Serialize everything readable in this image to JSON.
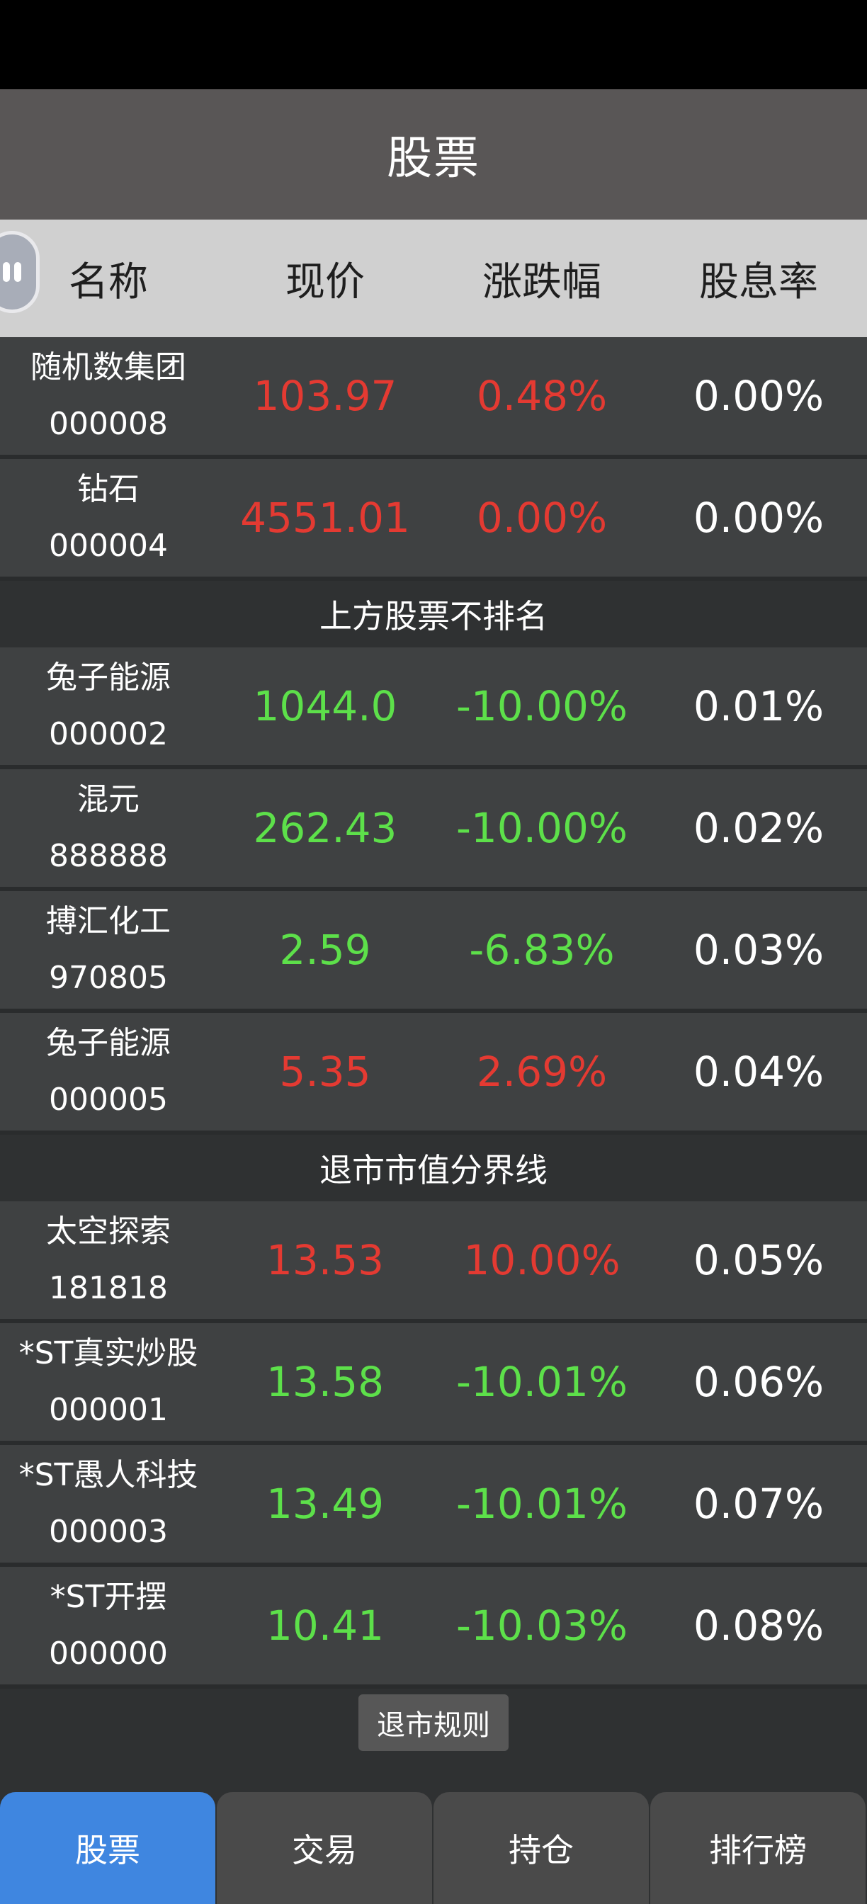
{
  "title": "股票",
  "header": {
    "name": "名称",
    "price": "现价",
    "change": "涨跌幅",
    "yield": "股息率"
  },
  "rows_top": [
    {
      "name": "随机数集团",
      "code": "000008",
      "price": "103.97",
      "change": "0.48%",
      "yield": "0.00%",
      "trend": "up"
    },
    {
      "name": "钻石",
      "code": "000004",
      "price": "4551.01",
      "change": "0.00%",
      "yield": "0.00%",
      "trend": "up"
    }
  ],
  "divider1": "上方股票不排名",
  "rows_mid": [
    {
      "name": "兔子能源",
      "code": "000002",
      "price": "1044.0",
      "change": "-10.00%",
      "yield": "0.01%",
      "trend": "down"
    },
    {
      "name": "混元",
      "code": "888888",
      "price": "262.43",
      "change": "-10.00%",
      "yield": "0.02%",
      "trend": "down"
    },
    {
      "name": "搏汇化工",
      "code": "970805",
      "price": "2.59",
      "change": "-6.83%",
      "yield": "0.03%",
      "trend": "down"
    },
    {
      "name": "兔子能源",
      "code": "000005",
      "price": "5.35",
      "change": "2.69%",
      "yield": "0.04%",
      "trend": "up"
    }
  ],
  "divider2": "退市市值分界线",
  "rows_bottom": [
    {
      "name": "太空探索",
      "code": "181818",
      "price": "13.53",
      "change": "10.00%",
      "yield": "0.05%",
      "trend": "up"
    },
    {
      "name": "*ST真实炒股",
      "code": "000001",
      "price": "13.58",
      "change": "-10.01%",
      "yield": "0.06%",
      "trend": "down"
    },
    {
      "name": "*ST愚人科技",
      "code": "000003",
      "price": "13.49",
      "change": "-10.01%",
      "yield": "0.07%",
      "trend": "down"
    },
    {
      "name": "*ST开摆",
      "code": "000000",
      "price": "10.41",
      "change": "-10.03%",
      "yield": "0.08%",
      "trend": "down"
    }
  ],
  "delist_rules": "退市规则",
  "nav": [
    {
      "label": "股票",
      "active": true
    },
    {
      "label": "交易",
      "active": false
    },
    {
      "label": "持仓",
      "active": false
    },
    {
      "label": "排行榜",
      "active": false
    }
  ],
  "colors": {
    "up": "#e43a32",
    "down": "#5de04a",
    "nav_active": "#3f86e0"
  }
}
